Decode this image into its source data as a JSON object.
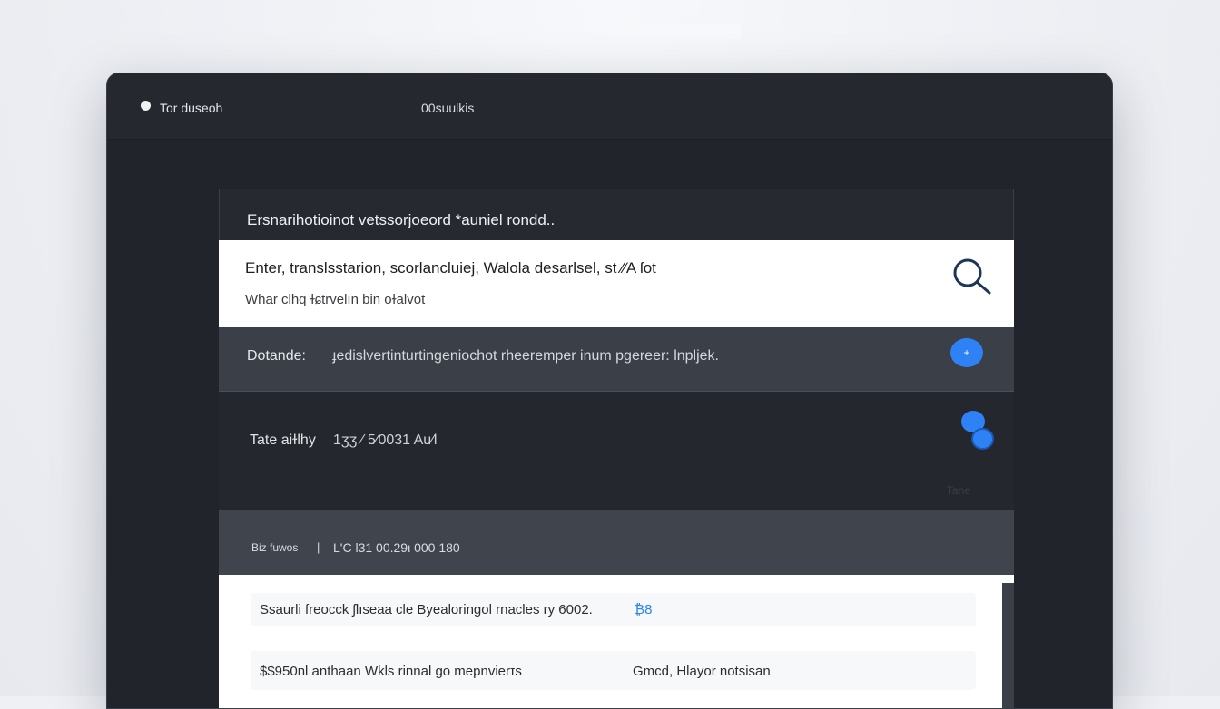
{
  "window": {
    "app_name": "Tor duseoh",
    "status": "00suulkis"
  },
  "panel": {
    "header": "Ersnarihotioinot vetssorjoeord *auniel rondd..",
    "search": {
      "line1": "Enter, translsstarion, scorlancluiej, Walola desarlsel, st ⁄⁄A   ſot",
      "line2": "Whar clhq ɫɕtrvelın bin oɫalvot",
      "icon": "search-icon"
    },
    "detail": {
      "label": "Dotande:",
      "value": "ɟedislvertinturtingeniochot rheeremper inum pgereer: lnpljek.",
      "add_icon": "plus-icon",
      "add_label": "+"
    },
    "time": {
      "label": "Tate aiɫlhy",
      "value": "1ʒʒ ⁄ 5⁄0031 Au⁄l",
      "faint_label": "Tane"
    },
    "summary": {
      "left": "Biz fuwos",
      "separator": "|",
      "right": "L'C l31  00.29ι  000 180"
    },
    "results": [
      {
        "text": "Ssaurli freocck ʃlıseaa cle Byealoringol rnacles ry 6002.",
        "link": "₿8"
      },
      {
        "text": "$$950nl anthaan Wkls rinnal go mepnvierɪs",
        "meta": "Gmcd,  Hlayor notsisan"
      }
    ]
  },
  "colors": {
    "accent": "#2e82f5",
    "device_bg": "#21242a",
    "panel_light": "#ffffff",
    "row_mid": "#3b3f48"
  }
}
